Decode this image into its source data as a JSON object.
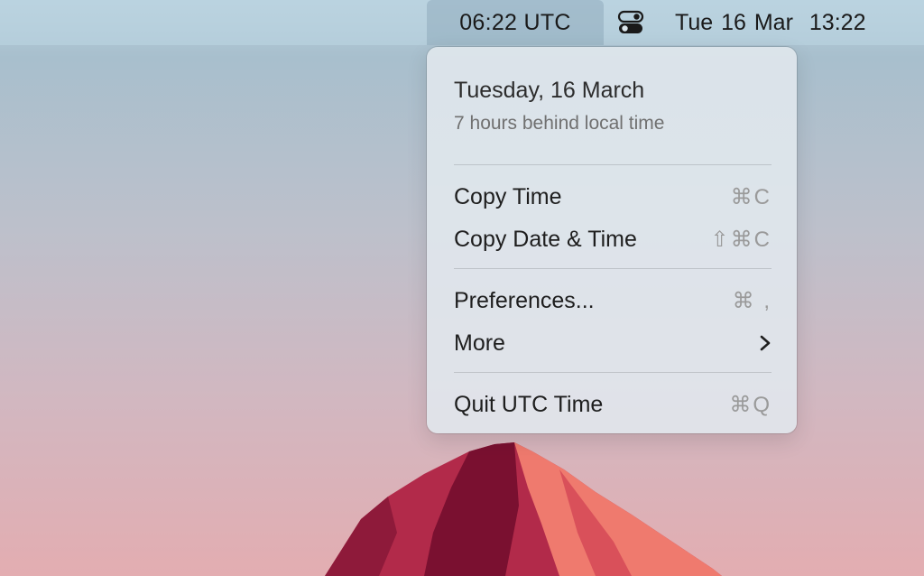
{
  "menubar": {
    "utc_time": "06:22 UTC",
    "control_center_icon": "control-center-toggle-icon",
    "date": "Tue 16 Mar",
    "time": "13:22"
  },
  "menu": {
    "title": "Tuesday, 16 March",
    "subtitle": "7 hours behind local time",
    "items": [
      {
        "label": "Copy Time",
        "shortcut": "⌘C"
      },
      {
        "label": "Copy Date & Time",
        "shortcut": "⇧⌘C"
      },
      {
        "label": "Preferences...",
        "shortcut": "⌘ ,"
      },
      {
        "label": "More",
        "icon": "chevron-right-icon"
      },
      {
        "label": "Quit UTC Time",
        "shortcut": "⌘Q"
      }
    ]
  },
  "colors": {
    "mountain_dark": "#7a1030",
    "mountain_mid": "#b22a4a",
    "mountain_light": "#ef7a6e"
  }
}
